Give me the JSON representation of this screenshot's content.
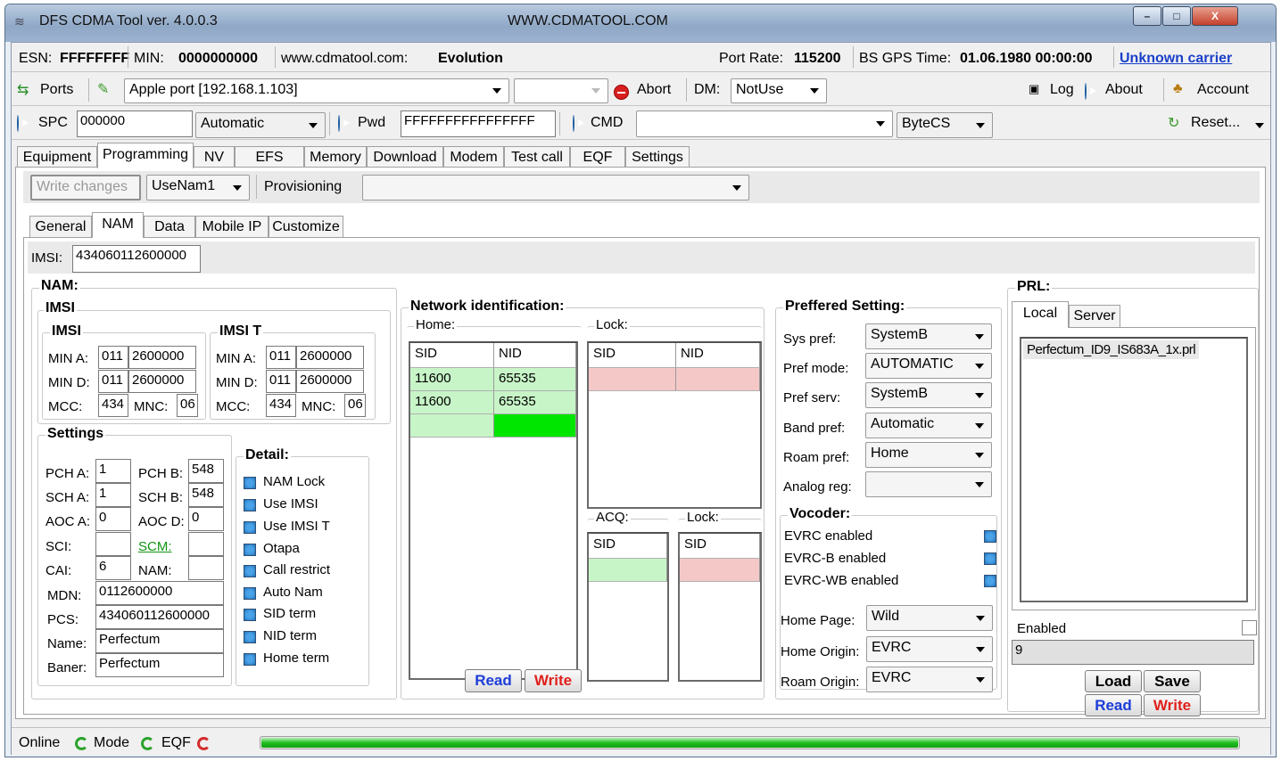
{
  "window": {
    "title": "DFS CDMA Tool ver. 4.0.0.3",
    "url": "WWW.CDMATOOL.COM",
    "minimize": "–",
    "maximize": "□",
    "close": "X"
  },
  "info": {
    "esn_label": "ESN:",
    "esn": "FFFFFFFF",
    "min_label": "MIN:",
    "min": "0000000000",
    "site_label": "www.cdmatool.com:",
    "site_value": "Evolution",
    "port_rate_label": "Port Rate:",
    "port_rate": "115200",
    "bs_gps_label": "BS GPS Time:",
    "bs_gps": "01.06.1980 00:00:00",
    "carrier": "Unknown carrier"
  },
  "toolbar1": {
    "ports": "Ports",
    "port_value": "Apple port [192.168.1.103]",
    "abort": "Abort",
    "dm_label": "DM:",
    "dm_value": "NotUse",
    "log": "Log",
    "about": "About",
    "account": "Account"
  },
  "toolbar2": {
    "spc": "SPC",
    "spc_value": "000000",
    "spc_mode": "Automatic",
    "pwd": "Pwd",
    "pwd_value": "FFFFFFFFFFFFFFFF",
    "cmd": "CMD",
    "cmd_value": "",
    "bytecs": "ByteCS",
    "reset": "Reset..."
  },
  "main_tabs": [
    "Equipment",
    "Programming",
    "NV",
    "EFS",
    "Memory",
    "Download",
    "Modem",
    "Test call",
    "EQF",
    "Settings"
  ],
  "prog": {
    "write_changes": "Write changes",
    "nam_select": "UseNam1",
    "provisioning": "Provisioning",
    "provisioning_value": ""
  },
  "sub_tabs": [
    "General",
    "NAM",
    "Data",
    "Mobile IP",
    "Customize"
  ],
  "imsi_label": "IMSI:",
  "imsi_value": "434060112600000",
  "nam": {
    "title": "NAM:",
    "imsi_group": "IMSI",
    "imsi": {
      "title": "IMSI",
      "min_a": "MIN A:",
      "min_a1": "011",
      "min_a2": "2600000",
      "min_d": "MIN D:",
      "min_d1": "011",
      "min_d2": "2600000",
      "mcc": "MCC:",
      "mcc_v": "434",
      "mnc": "MNC:",
      "mnc_v": "06"
    },
    "imsi_t": {
      "title": "IMSI T",
      "min_a": "MIN A:",
      "min_a1": "011",
      "min_a2": "2600000",
      "min_d": "MIN D:",
      "min_d1": "011",
      "min_d2": "2600000",
      "mcc": "MCC:",
      "mcc_v": "434",
      "mnc": "MNC:",
      "mnc_v": "06"
    },
    "settings": {
      "title": "Settings",
      "pch_a": "PCH A:",
      "pch_a_v": "1",
      "pch_b": "PCH B:",
      "pch_b_v": "548",
      "sch_a": "SCH A:",
      "sch_a_v": "1",
      "sch_b": "SCH B:",
      "sch_b_v": "548",
      "aoc_a": "AOC A:",
      "aoc_a_v": "0",
      "aoc_d": "AOC D:",
      "aoc_d_v": "0",
      "sci": "SCI:",
      "sci_v": "",
      "scm": "SCM:",
      "scm_v": "",
      "cai": "CAI:",
      "cai_v": "6",
      "nam": "NAM:",
      "nam_v": "",
      "mdn": "MDN:",
      "mdn_v": "0112600000",
      "pcs": "PCS:",
      "pcs_v": "434060112600000",
      "name": "Name:",
      "name_v": "Perfectum",
      "baner": "Baner:",
      "baner_v": "Perfectum"
    },
    "detail": {
      "title": "Detail:",
      "items": [
        "NAM Lock",
        "Use IMSI",
        "Use IMSI T",
        "Otapa",
        "Call restrict",
        "Auto Nam",
        "SID term",
        "NID term",
        "Home term"
      ]
    }
  },
  "network": {
    "title": "Network identification:",
    "home": "Home:",
    "lock": "Lock:",
    "sid": "SID",
    "nid": "NID",
    "home_rows": [
      [
        "11600",
        "65535"
      ],
      [
        "11600",
        "65535"
      ]
    ],
    "acq": "ACQ:",
    "lock2": "Lock:",
    "read": "Read",
    "write": "Write"
  },
  "pref": {
    "title": "Preffered Setting:",
    "rows": [
      [
        "Sys pref:",
        "SystemB"
      ],
      [
        "Pref mode:",
        "AUTOMATIC"
      ],
      [
        "Pref serv:",
        "SystemB"
      ],
      [
        "Band pref:",
        "Automatic"
      ],
      [
        "Roam pref:",
        "Home"
      ],
      [
        "Analog reg:",
        ""
      ]
    ],
    "vocoder": "Vocoder:",
    "voc_items": [
      "EVRC enabled",
      "EVRC-B enabled",
      "EVRC-WB enabled"
    ],
    "home_page": "Home Page:",
    "home_page_v": "Wild",
    "home_origin": "Home Origin:",
    "home_origin_v": "EVRC",
    "roam_origin": "Roam Origin:",
    "roam_origin_v": "EVRC"
  },
  "prl": {
    "title": "PRL:",
    "tab_local": "Local",
    "tab_server": "Server",
    "file": "Perfectum_ID9_IS683A_1x.prl",
    "enabled": "Enabled",
    "value": "9",
    "load": "Load",
    "save": "Save",
    "read": "Read",
    "write": "Write"
  },
  "status": {
    "online": "Online",
    "mode": "Mode",
    "eqf": "EQF",
    "progress": 1.0
  },
  "colors": {
    "green_cell": "#c8f5c8",
    "bright_green": "#00e600",
    "pink": "#f5c8c8",
    "link": "#1a3fc9",
    "progress": "#1fbf1f"
  }
}
